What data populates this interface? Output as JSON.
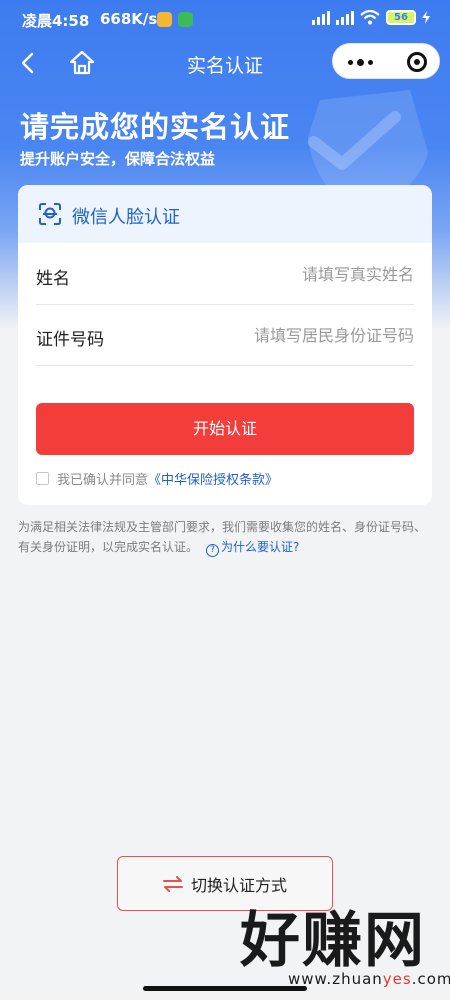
{
  "status_bar": {
    "time": "凌晨4:58",
    "speed": "668K/s",
    "battery": "56"
  },
  "nav": {
    "title": "实名认证"
  },
  "hero": {
    "heading": "请完成您的实名认证",
    "subheading": "提升账户安全，保障合法权益"
  },
  "card": {
    "title": "微信人脸认证",
    "fields": {
      "name_label": "姓名",
      "name_placeholder": "请填写真实姓名",
      "id_label": "证件号码",
      "id_placeholder": "请填写居民身份证号码"
    },
    "submit_label": "开始认证",
    "agree_text": "我已确认并同意",
    "agree_link": "《中华保险授权条款》"
  },
  "note": {
    "text": "为满足相关法律法规及主管部门要求，我们需要收集您的姓名、身份证号码、有关身份证明，以完成实名认证。",
    "link": "为什么要认证?"
  },
  "switch_label": "切换认证方式",
  "watermark": {
    "brand": "好赚网",
    "url_prefix": "www.zhuan",
    "url_highlight": "yes",
    "url_suffix": ".com"
  },
  "colors": {
    "primary_blue": "#3d7cf0",
    "link_blue": "#1f62c9",
    "accent_red": "#f23d3a"
  }
}
